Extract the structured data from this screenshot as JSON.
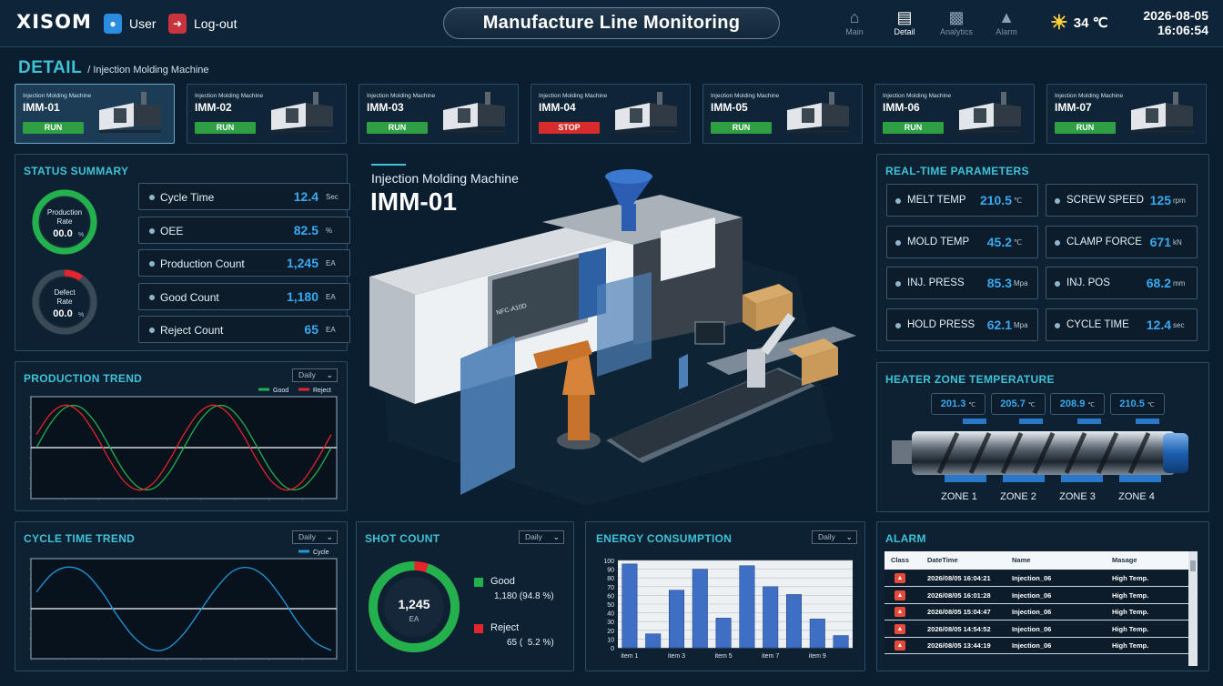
{
  "header": {
    "logo": "XISOM",
    "user_label": "User",
    "logout_label": "Log-out",
    "title": "Manufacture Line Monitoring",
    "nav": [
      {
        "label": "Main",
        "icon": "home-icon"
      },
      {
        "label": "Detail",
        "icon": "document-icon",
        "active": true
      },
      {
        "label": "Analytics",
        "icon": "bar-chart-icon"
      },
      {
        "label": "Alarm",
        "icon": "bell-icon"
      }
    ],
    "temperature": "34 ℃",
    "date": "2026-08-05",
    "time": "16:06:54"
  },
  "breadcrumb": {
    "page": "DETAIL",
    "sub": "/ Injection Molding Machine"
  },
  "machines": [
    {
      "type": "Injection Molding Machine",
      "name": "IMM-01",
      "status": "RUN",
      "selected": true
    },
    {
      "type": "Injection Molding Machine",
      "name": "IMM-02",
      "status": "RUN"
    },
    {
      "type": "Injection Molding Machine",
      "name": "IMM-03",
      "status": "RUN"
    },
    {
      "type": "Injection Molding Machine",
      "name": "IMM-04",
      "status": "STOP"
    },
    {
      "type": "Injection Molding Machine",
      "name": "IMM-05",
      "status": "RUN"
    },
    {
      "type": "Injection Molding Machine",
      "name": "IMM-06",
      "status": "RUN"
    },
    {
      "type": "Injection Molding Machine",
      "name": "IMM-07",
      "status": "RUN"
    }
  ],
  "colors": {
    "run": "#2ea043",
    "stop": "#d62c2c",
    "accent": "#3ec2d6",
    "value": "#3aa9f0"
  },
  "status_summary": {
    "title": "STATUS SUMMARY",
    "production_rate": {
      "label1": "Production",
      "label2": "Rate",
      "value": "00.0",
      "unit": "%"
    },
    "defect_rate": {
      "label1": "Defect",
      "label2": "Rate",
      "value": "00.0",
      "unit": "%"
    },
    "kpis": [
      {
        "label": "Cycle Time",
        "value": "12.4",
        "unit": "Sec"
      },
      {
        "label": "OEE",
        "value": "82.5",
        "unit": "%"
      },
      {
        "label": "Production Count",
        "value": "1,245",
        "unit": "EA"
      },
      {
        "label": "Good Count",
        "value": "1,180",
        "unit": "EA"
      },
      {
        "label": "Reject Count",
        "value": "65",
        "unit": "EA"
      }
    ]
  },
  "center": {
    "subtitle": "Injection Molding Machine",
    "machine": "IMM-01",
    "machine_label": "NFC-A10D"
  },
  "parameters": {
    "title": "REAL-TIME PARAMETERS",
    "items": [
      {
        "label": "MELT TEMP",
        "value": "210.5",
        "unit": "℃"
      },
      {
        "label": "SCREW SPEED",
        "value": "125",
        "unit": "rpm"
      },
      {
        "label": "MOLD TEMP",
        "value": "45.2",
        "unit": "℃"
      },
      {
        "label": "CLAMP FORCE",
        "value": "671",
        "unit": "kN"
      },
      {
        "label": "INJ. PRESS",
        "value": "85.3",
        "unit": "Mpa"
      },
      {
        "label": "INJ. POS",
        "value": "68.2",
        "unit": "mm"
      },
      {
        "label": "HOLD PRESS",
        "value": "62.1",
        "unit": "Mpa"
      },
      {
        "label": "CYCLE TIME",
        "value": "12.4",
        "unit": "sec"
      }
    ]
  },
  "heater": {
    "title": "HEATER ZONE TEMPERATURE",
    "zones": [
      {
        "label": "ZONE 1",
        "value": "201.3",
        "unit": "℃"
      },
      {
        "label": "ZONE 2",
        "value": "205.7",
        "unit": "℃"
      },
      {
        "label": "ZONE 3",
        "value": "208.9",
        "unit": "℃"
      },
      {
        "label": "ZONE 4",
        "value": "210.5",
        "unit": "℃"
      }
    ]
  },
  "production_trend": {
    "title": "PRODUCTION TREND",
    "period": "Daily",
    "legend": [
      {
        "name": "Good",
        "color": "#22b14c"
      },
      {
        "name": "Reject",
        "color": "#e5242b"
      }
    ]
  },
  "cycle_trend": {
    "title": "CYCLE TIME TREND",
    "period": "Daily",
    "legend": [
      {
        "name": "Cycle",
        "color": "#1e9be0"
      }
    ]
  },
  "shot_count": {
    "title": "SHOT COUNT",
    "period": "Daily",
    "total": "1,245",
    "unit": "EA",
    "good_label": "Good",
    "good_value": "1,180 (94.8 %)",
    "reject_label": "Reject",
    "reject_value": "65 (  5.2 %)",
    "good_fraction": 0.948
  },
  "energy": {
    "title": "ENERGY CONSUMPTION",
    "period": "Daily"
  },
  "alarm": {
    "title": "ALARM",
    "columns": [
      "Class",
      "DateTime",
      "Name",
      "Masage"
    ],
    "rows": [
      {
        "datetime": "2026/08/05 16:04:21",
        "name": "Injection_06",
        "message": "High Temp."
      },
      {
        "datetime": "2026/08/05 16:01:28",
        "name": "Injection_06",
        "message": "High Temp."
      },
      {
        "datetime": "2026/08/05 15:04:47",
        "name": "Injection_06",
        "message": "High Temp."
      },
      {
        "datetime": "2026/08/05 14:54:52",
        "name": "Injection_06",
        "message": "High Temp."
      },
      {
        "datetime": "2026/08/05 13:44:19",
        "name": "Injection_06",
        "message": "High Temp."
      }
    ]
  },
  "chart_data": [
    {
      "type": "line",
      "title": "PRODUCTION TREND",
      "series": [
        {
          "name": "Good",
          "values": [
            0,
            0.59,
            0.95,
            0.95,
            0.59,
            0,
            -0.59,
            -0.95,
            -0.95,
            -0.59,
            0,
            0.59,
            0.95,
            0.95,
            0.59,
            0,
            -0.59,
            -0.95,
            -0.95,
            -0.59,
            0
          ]
        },
        {
          "name": "Reject",
          "values": [
            0.31,
            0.81,
            1.0,
            0.81,
            0.31,
            -0.31,
            -0.81,
            -1.0,
            -0.81,
            -0.31,
            0.31,
            0.81,
            1.0,
            0.81,
            0.31,
            -0.31,
            -0.81,
            -1.0,
            -0.81,
            -0.31,
            0.31
          ]
        }
      ],
      "ylim": [
        -1.2,
        1.2
      ],
      "grid": false,
      "legend": "top-right"
    },
    {
      "type": "line",
      "title": "CYCLE TIME TREND",
      "series": [
        {
          "name": "Cycle",
          "values": [
            0.4,
            0.85,
            1.0,
            0.85,
            0.4,
            -0.2,
            -0.7,
            -0.98,
            -0.95,
            -0.6,
            -0.05,
            0.5,
            0.9,
            0.98,
            0.75,
            0.25,
            -0.35,
            -0.8,
            -1.0
          ]
        }
      ],
      "ylim": [
        -1.2,
        1.2
      ],
      "grid": false,
      "legend": "top-right"
    },
    {
      "type": "bar",
      "title": "ENERGY CONSUMPTION",
      "categories": [
        "item 1",
        "item 2",
        "item 3",
        "item 4",
        "item 5",
        "item 6",
        "item 7",
        "item 8",
        "item 9",
        "item 10"
      ],
      "tick_labels": [
        "item 1",
        "",
        "item 3",
        "",
        "item 5",
        "",
        "item 7",
        "",
        "item 9",
        ""
      ],
      "values": [
        96,
        16,
        66,
        90,
        34,
        94,
        70,
        61,
        33,
        14
      ],
      "ylim": [
        0,
        100
      ],
      "yticks": [
        0,
        10,
        20,
        30,
        40,
        50,
        60,
        70,
        80,
        90,
        100
      ],
      "grid": true
    }
  ]
}
